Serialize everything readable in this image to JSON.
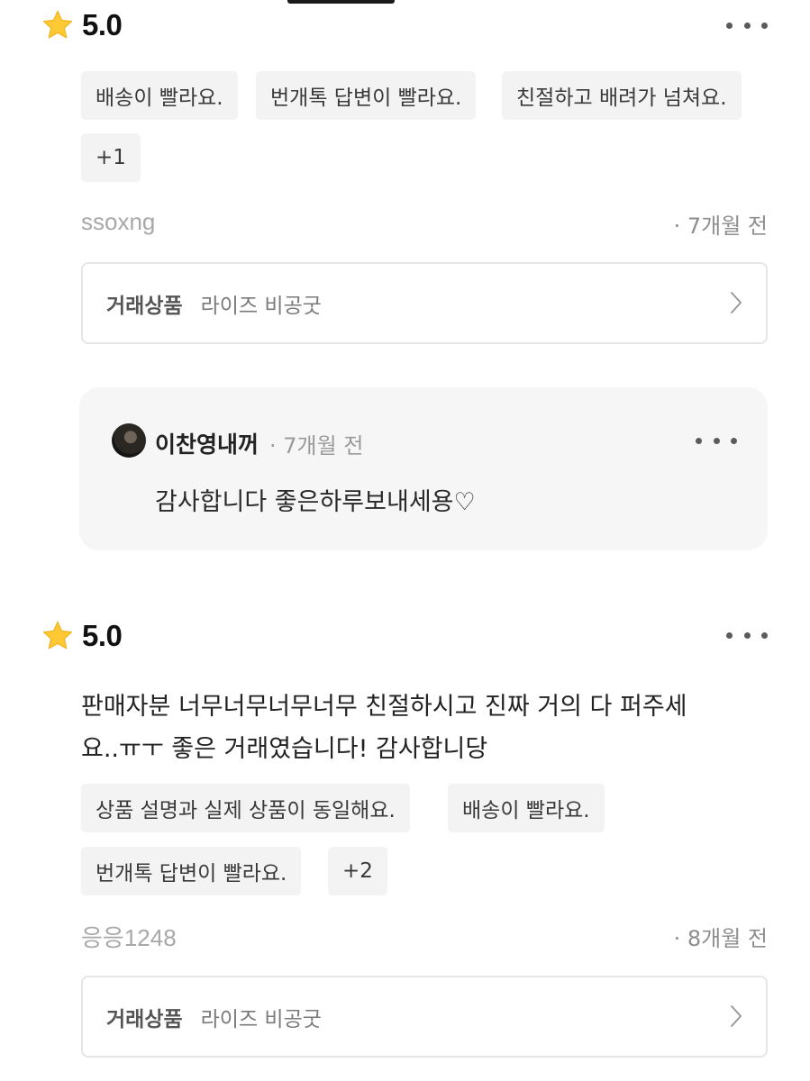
{
  "reviews": [
    {
      "score": "5.0",
      "tags": [
        "배송이 빨라요.",
        "번개톡 답변이 빨라요.",
        "친절하고 배려가 넘쳐요.",
        "+1"
      ],
      "author": "ssoxng",
      "time": "· 7개월 전",
      "product": {
        "label": "거래상품",
        "name": "라이즈 비공굿"
      },
      "reply": {
        "author": "이찬영내꺼",
        "time": "· 7개월 전",
        "text": "감사합니다 좋은하루보내세용♡"
      }
    },
    {
      "score": "5.0",
      "text_line1": "판매자분 너무너무너무너무 친절하시고 진짜 거의 다 퍼주세",
      "text_line2": "요..ㅠㅜ 좋은 거래였습니다! 감사합니당",
      "tags": [
        "상품 설명과 실제 상품이 동일해요.",
        "배송이 빨라요.",
        "번개톡 답변이 빨라요.",
        "+2"
      ],
      "author": "응응1248",
      "time": "· 8개월 전",
      "product": {
        "label": "거래상품",
        "name": "라이즈 비공굿"
      }
    }
  ],
  "icons": {
    "star": "star-icon",
    "more": "more-icon",
    "chevron": "chevron-right-icon"
  },
  "colors": {
    "star": "#FFC933",
    "chip_bg": "#F3F3F3",
    "reply_bg": "#F6F6F6"
  }
}
